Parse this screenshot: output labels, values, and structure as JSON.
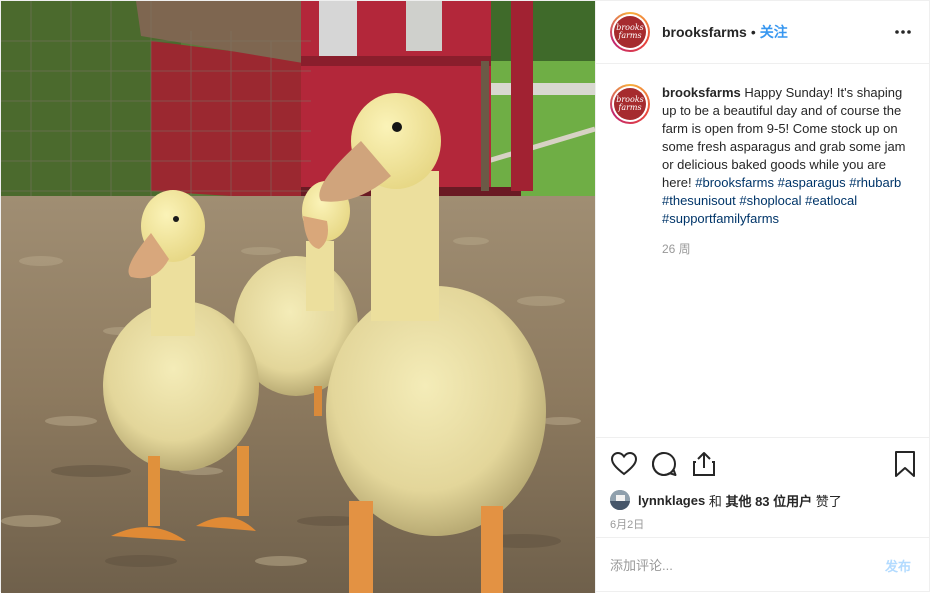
{
  "header": {
    "username": "brooksfarms",
    "separator": "•",
    "follow_label": "关注",
    "more_icon": "more-horizontal-icon",
    "avatar_logo_text": "brooks farms"
  },
  "caption": {
    "username": "brooksfarms",
    "text": "Happy Sunday! It's shaping up to be a beautiful day and of course the farm is open from 9-5! Come stock up on some fresh asparagus and grab some jam or delicious baked goods while you are here!",
    "hashtags": [
      "#brooksfarms",
      "#asparagus",
      "#rhubarb",
      "#thesunisout",
      "#shoplocal",
      "#eatlocal",
      "#supportfamilyfarms"
    ],
    "time": "26 周"
  },
  "actions": {
    "like_icon": "heart-icon",
    "comment_icon": "comment-icon",
    "share_icon": "share-icon",
    "save_icon": "bookmark-icon"
  },
  "likes": {
    "user": "lynnklages",
    "conj": "和",
    "others": "其他 83 位用户",
    "suffix": "赞了"
  },
  "date": "6月2日",
  "compose": {
    "placeholder": "添加评论...",
    "post_label": "发布"
  },
  "colors": {
    "link": "#3897f0",
    "hashtag": "#003569",
    "muted": "#999999",
    "post_disabled": "#b3dbff"
  }
}
